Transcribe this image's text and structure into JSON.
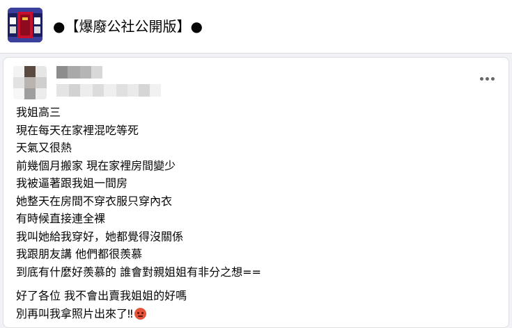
{
  "group": {
    "avatar_icon": "group-avatar-image",
    "title": "●【爆廢公社公開版】●"
  },
  "post": {
    "more_icon": "more-options-icon",
    "lines": [
      "我姐高三",
      "現在每天在家裡混吃等死",
      "天氣又很熱",
      "前幾個月搬家 現在家裡房間變少",
      "我被逼著跟我姐一間房",
      "她整天在房間不穿衣服只穿內衣",
      "有時候直接連全裸",
      "我叫她給我穿好，她都覺得沒關係",
      "我跟朋友講 他們都很羨慕",
      "到底有什麼好羨慕的 誰會對親姐姐有非分之想=="
    ],
    "lines2": [
      "好了各位 我不會出賣我姐姐的好嗎"
    ],
    "last_line": "別再叫我拿照片出來了‼",
    "emoji_icon": "angry-face-emoji"
  }
}
